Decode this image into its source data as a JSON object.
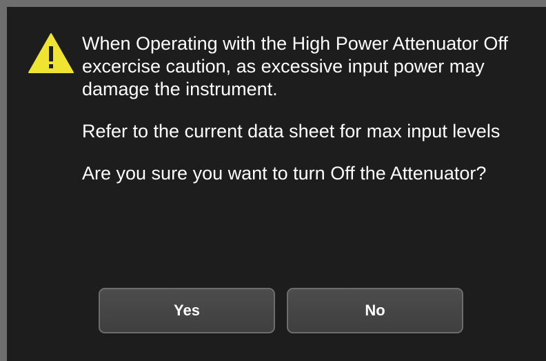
{
  "dialog": {
    "icon": "warning-triangle-icon",
    "icon_color": "#f0e432",
    "background_color": "#1d1d1d",
    "paragraphs": [
      "When Operating with the High Power Attenuator Off excercise caution, as excessive input power may damage the instrument.",
      "Refer to the current data sheet for max input levels",
      "Are you sure you want to turn Off the Attenuator?"
    ],
    "buttons": {
      "yes_label": "Yes",
      "no_label": "No"
    }
  }
}
